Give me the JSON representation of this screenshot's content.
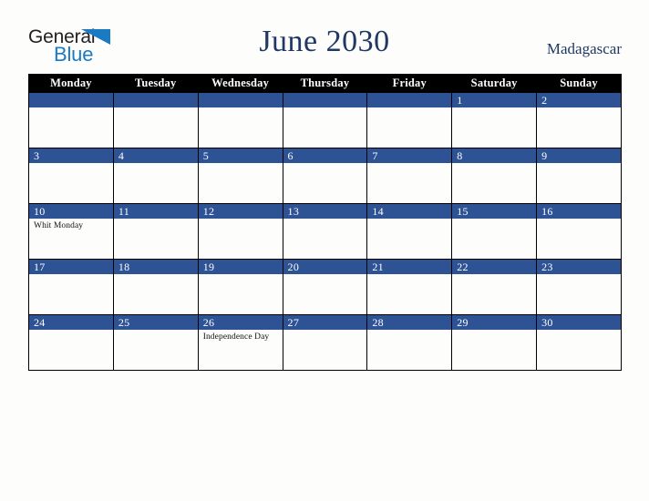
{
  "brand": {
    "word_one": "General",
    "word_two": "Blue",
    "triangle_icon": "triangle-icon",
    "accent_color": "#1b7ac4"
  },
  "header": {
    "title": "June 2030",
    "country": "Madagascar",
    "title_color": "#1f3864"
  },
  "calendar": {
    "band_color": "#2e5395",
    "header_bg": "#000000",
    "weekdays": [
      "Monday",
      "Tuesday",
      "Wednesday",
      "Thursday",
      "Friday",
      "Saturday",
      "Sunday"
    ],
    "weeks": [
      [
        {
          "day": "",
          "events": []
        },
        {
          "day": "",
          "events": []
        },
        {
          "day": "",
          "events": []
        },
        {
          "day": "",
          "events": []
        },
        {
          "day": "",
          "events": []
        },
        {
          "day": "1",
          "events": []
        },
        {
          "day": "2",
          "events": []
        }
      ],
      [
        {
          "day": "3",
          "events": []
        },
        {
          "day": "4",
          "events": []
        },
        {
          "day": "5",
          "events": []
        },
        {
          "day": "6",
          "events": []
        },
        {
          "day": "7",
          "events": []
        },
        {
          "day": "8",
          "events": []
        },
        {
          "day": "9",
          "events": []
        }
      ],
      [
        {
          "day": "10",
          "events": [
            "Whit Monday"
          ]
        },
        {
          "day": "11",
          "events": []
        },
        {
          "day": "12",
          "events": []
        },
        {
          "day": "13",
          "events": []
        },
        {
          "day": "14",
          "events": []
        },
        {
          "day": "15",
          "events": []
        },
        {
          "day": "16",
          "events": []
        }
      ],
      [
        {
          "day": "17",
          "events": []
        },
        {
          "day": "18",
          "events": []
        },
        {
          "day": "19",
          "events": []
        },
        {
          "day": "20",
          "events": []
        },
        {
          "day": "21",
          "events": []
        },
        {
          "day": "22",
          "events": []
        },
        {
          "day": "23",
          "events": []
        }
      ],
      [
        {
          "day": "24",
          "events": []
        },
        {
          "day": "25",
          "events": []
        },
        {
          "day": "26",
          "events": [
            "Independence Day"
          ]
        },
        {
          "day": "27",
          "events": []
        },
        {
          "day": "28",
          "events": []
        },
        {
          "day": "29",
          "events": []
        },
        {
          "day": "30",
          "events": []
        }
      ]
    ]
  }
}
